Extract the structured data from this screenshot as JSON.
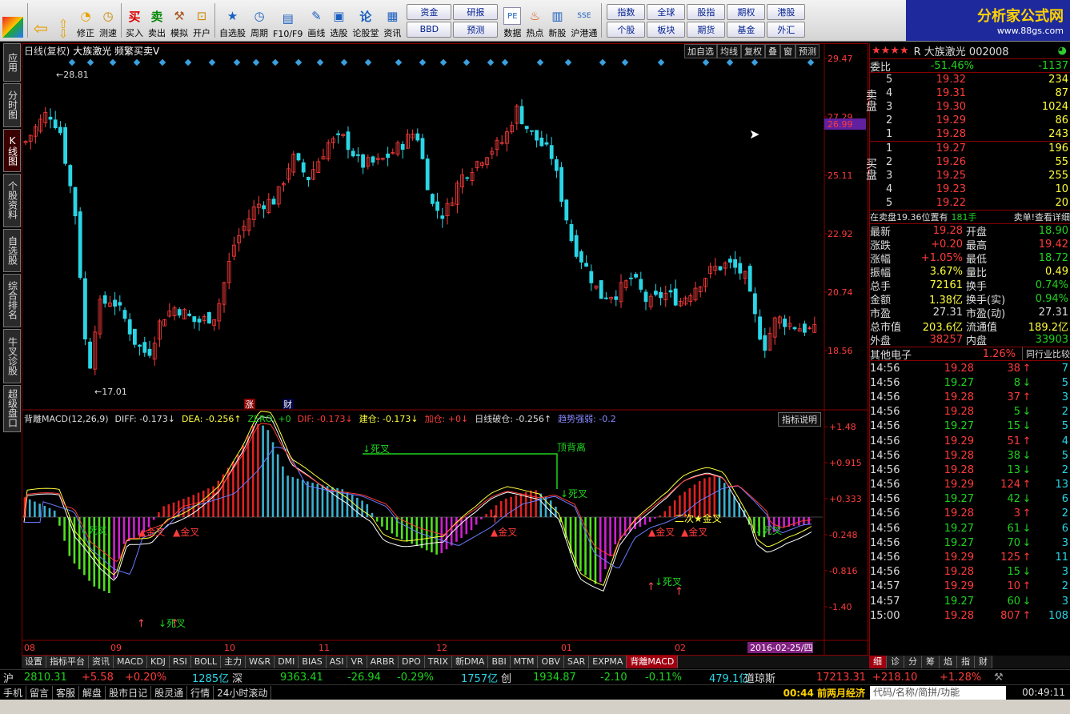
{
  "toolbar": {
    "buttons": [
      {
        "label": "",
        "icon": "grid-icon"
      },
      {
        "label": "",
        "icon": "back-icon"
      },
      {
        "label": "",
        "icon": "updown-icon"
      },
      {
        "label": "修正",
        "icon": "fix-icon"
      },
      {
        "label": "测速",
        "icon": "clock-icon"
      },
      {
        "label": "买入",
        "icon": "buy-icon"
      },
      {
        "label": "卖出",
        "icon": "sell-icon"
      },
      {
        "label": "模拟",
        "icon": "hammer-icon"
      },
      {
        "label": "开户",
        "icon": "lock-icon"
      },
      {
        "label": "自选股",
        "icon": "star-icon"
      },
      {
        "label": "周期",
        "icon": "period-icon"
      },
      {
        "label": "F10/F9",
        "icon": "f10-icon"
      },
      {
        "label": "画线",
        "icon": "pen-icon"
      },
      {
        "label": "选股",
        "icon": "select-icon"
      },
      {
        "label": "论股堂",
        "icon": "forum-icon"
      },
      {
        "label": "资讯",
        "icon": "news-icon"
      }
    ],
    "grid1": [
      "资金",
      "研报",
      "BBD",
      "预测"
    ],
    "grid2_labels": [
      "数据",
      "热点",
      "新股",
      "沪港通"
    ],
    "grid3": [
      "指数",
      "全球",
      "股指",
      "期权",
      "港股",
      "个股",
      "板块",
      "期货",
      "基金",
      "外汇"
    ],
    "logo_title": "分析家公式网",
    "logo_url": "www.88gs.com"
  },
  "left_tabs": [
    "应用",
    "分时图",
    "K线图",
    "个股资料",
    "自选股",
    "综合排名",
    "牛叉诊股",
    "超级盘口"
  ],
  "chart": {
    "title_prefix": "日线(复权)",
    "stock_name": "大族激光",
    "formula": "频繁买卖V",
    "buttons": [
      "加自选",
      "均线",
      "复权",
      "叠",
      "窗",
      "预测"
    ],
    "high_label": "28.81",
    "low_label": "17.01",
    "price_axis": [
      "29.47",
      "27.29",
      "25.11",
      "22.92",
      "20.74",
      "18.56"
    ],
    "current_price_tag": "26.99",
    "macd_axis": [
      "+1.48",
      "+0.915",
      "+0.333",
      "-0.248",
      "-0.816",
      "-1.40"
    ],
    "date_labels": [
      "08",
      "09",
      "10",
      "11",
      "12",
      "01",
      "02"
    ],
    "date_tag": "2016-02-25/四",
    "marks": {
      "zhang": "涨",
      "cai": "财"
    },
    "indicator_line": [
      {
        "t": "背離MACD(12,26,9)",
        "c": "#dddddd"
      },
      {
        "t": "DIFF: -0.173↓",
        "c": "#dddddd"
      },
      {
        "t": "DEA: -0.256↑",
        "c": "#ffff3b"
      },
      {
        "t": "ZERO: +0",
        "c": "#1fd31f"
      },
      {
        "t": "DIF: -0.173↓",
        "c": "#ff3b3b"
      },
      {
        "t": "建仓: -0.173↓",
        "c": "#ffff3b"
      },
      {
        "t": "加仓: +0↓",
        "c": "#ff3b3b"
      },
      {
        "t": "日线破仓: -0.256↑",
        "c": "#dddddd"
      },
      {
        "t": "趋势强弱: -0.2",
        "c": "#8888ff"
      }
    ],
    "indicator_button": "指标说明",
    "annotations": {
      "sicha": "死叉",
      "jincha": "金叉",
      "dingbeili": "顶背离",
      "erci": "二次★金叉"
    }
  },
  "quote": {
    "name": "R 大族激光 002008",
    "weibi_label": "委比",
    "weibi": "-51.46%",
    "weicha": "-1137",
    "sell_label": "卖盘",
    "buy_label": "买盘",
    "asks": [
      [
        "5",
        "19.32",
        "234"
      ],
      [
        "4",
        "19.31",
        "87"
      ],
      [
        "3",
        "19.30",
        "1024"
      ],
      [
        "2",
        "19.29",
        "86"
      ],
      [
        "1",
        "19.28",
        "243"
      ]
    ],
    "bids": [
      [
        "1",
        "19.27",
        "196"
      ],
      [
        "2",
        "19.26",
        "55"
      ],
      [
        "3",
        "19.25",
        "255"
      ],
      [
        "4",
        "19.23",
        "10"
      ],
      [
        "5",
        "19.22",
        "20"
      ]
    ],
    "info_line": "在卖盘19.36位置有",
    "info_vol": "181手",
    "info_link": "卖单!查看详细",
    "stats": [
      [
        "最新",
        "19.28",
        "开盘",
        "18.90"
      ],
      [
        "涨跌",
        "+0.20",
        "最高",
        "19.42"
      ],
      [
        "涨幅",
        "+1.05%",
        "最低",
        "18.72"
      ],
      [
        "振幅",
        "3.67%",
        "量比",
        "0.49"
      ],
      [
        "总手",
        "72161",
        "换手",
        "0.74%"
      ],
      [
        "金额",
        "1.38亿",
        "换手(实)",
        "0.94%"
      ],
      [
        "市盈",
        "27.31",
        "市盈(动)",
        "27.31"
      ],
      [
        "总市值",
        "203.6亿",
        "流通值",
        "189.2亿"
      ],
      [
        "外盘",
        "38257",
        "内盘",
        "33903"
      ]
    ],
    "sector": "其他电子",
    "sector_pct": "1.26%",
    "sector_btn": "同行业比较",
    "ticks": [
      [
        "14:56",
        "19.28",
        "38",
        "up",
        "7"
      ],
      [
        "14:56",
        "19.27",
        "8",
        "down",
        "5"
      ],
      [
        "14:56",
        "19.28",
        "37",
        "up",
        "3"
      ],
      [
        "14:56",
        "19.28",
        "5",
        "down",
        "2"
      ],
      [
        "14:56",
        "19.27",
        "15",
        "down",
        "5"
      ],
      [
        "14:56",
        "19.29",
        "51",
        "up",
        "4"
      ],
      [
        "14:56",
        "19.28",
        "38",
        "down",
        "5"
      ],
      [
        "14:56",
        "19.28",
        "13",
        "down",
        "2"
      ],
      [
        "14:56",
        "19.29",
        "124",
        "up",
        "13"
      ],
      [
        "14:56",
        "19.27",
        "42",
        "down",
        "6"
      ],
      [
        "14:56",
        "19.28",
        "3",
        "up",
        "2"
      ],
      [
        "14:56",
        "19.27",
        "61",
        "down",
        "6"
      ],
      [
        "14:56",
        "19.27",
        "70",
        "down",
        "3"
      ],
      [
        "14:56",
        "19.29",
        "125",
        "up",
        "11"
      ],
      [
        "14:56",
        "19.28",
        "15",
        "down",
        "3"
      ],
      [
        "14:57",
        "19.29",
        "10",
        "up",
        "2"
      ],
      [
        "14:57",
        "19.27",
        "60",
        "down",
        "3"
      ],
      [
        "15:00",
        "19.28",
        "807",
        "up",
        "108"
      ]
    ]
  },
  "bottom_tabs": [
    "设置",
    "指标平台",
    "资讯",
    "MACD",
    "KDJ",
    "RSI",
    "BOLL",
    "主力",
    "W&R",
    "DMI",
    "BIAS",
    "ASI",
    "VR",
    "ARBR",
    "DPO",
    "TRIX",
    "新DMA",
    "BBI",
    "MTM",
    "OBV",
    "SAR",
    "EXPMA",
    "背離MACD"
  ],
  "right_tabs": [
    "细",
    "诊",
    "分",
    "筹",
    "焰",
    "指",
    "财"
  ],
  "status": {
    "sh": "沪",
    "sh_idx": "2810.31",
    "sh_chg": "+5.58",
    "sh_pct": "+0.20%",
    "sh_amt": "1285亿",
    "sz": "深",
    "sz_idx": "9363.41",
    "sz_chg": "-26.94",
    "sz_pct": "-0.29%",
    "sz_amt": "1757亿",
    "cy": "创",
    "cy_idx": "1934.87",
    "cy_chg": "-2.10",
    "cy_pct": "-0.11%",
    "cy_amt": "479.1亿",
    "dj": "道琼斯",
    "dj_idx": "17213.31",
    "dj_chg": "+218.10",
    "dj_pct": "+1.28%"
  },
  "status2": {
    "items": [
      "手机",
      "留言",
      "客服",
      "解盘",
      "股市日记",
      "股灵通",
      "行情",
      "24小时滚动"
    ],
    "news": "00:44 前两月经济",
    "search": "代码/名称/简拼/功能",
    "time": "00:49:11"
  }
}
